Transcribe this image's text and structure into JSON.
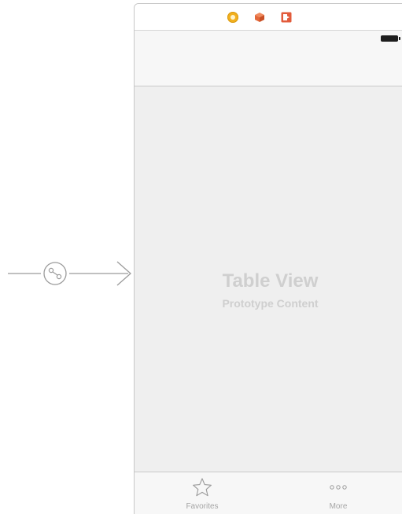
{
  "scene": {
    "dock_icons": [
      "view-controller-icon",
      "first-responder-icon",
      "exit-icon"
    ],
    "table_view": {
      "title": "Table View",
      "subtitle": "Prototype Content"
    },
    "tab_bar": {
      "items": [
        {
          "label": "Favorites",
          "icon": "star-icon"
        },
        {
          "label": "More",
          "icon": "more-dots-icon"
        }
      ]
    }
  },
  "colors": {
    "canvas": "#ffffff",
    "scene_background": "#efefef",
    "placeholder_text": "#cfcfcf",
    "tab_label": "#a5a5a5",
    "segue_line": "#9b9b9b",
    "view_controller_icon": "#f2b01e",
    "first_responder_icon": "#e3683a",
    "exit_icon": "#e25b3b"
  }
}
